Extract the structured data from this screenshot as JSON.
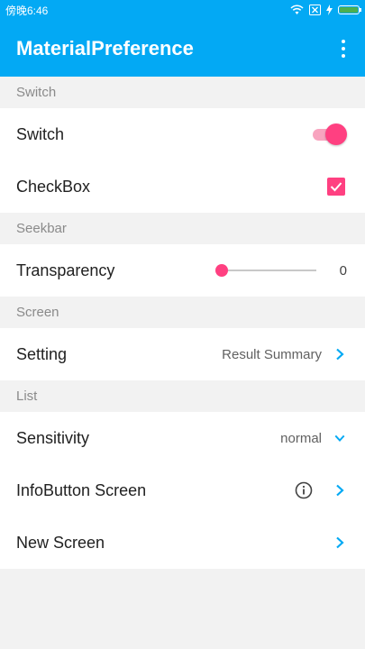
{
  "status": {
    "left_text": "傍晚6:46"
  },
  "app_bar": {
    "title": "MaterialPreference",
    "menu_icon": "overflow-menu-icon"
  },
  "colors": {
    "primary": "#03a9f4",
    "accent": "#ff4081"
  },
  "sections": {
    "switch": {
      "header": "Switch",
      "switch_row": {
        "title": "Switch",
        "checked": true
      },
      "checkbox_row": {
        "title": "CheckBox",
        "checked": true
      }
    },
    "seekbar": {
      "header": "Seekbar",
      "transparency": {
        "title": "Transparency",
        "value": "0"
      }
    },
    "screen": {
      "header": "Screen",
      "setting": {
        "title": "Setting",
        "summary": "Result Summary",
        "icon": "chevron-right-icon"
      }
    },
    "list": {
      "header": "List",
      "sensitivity": {
        "title": "Sensitivity",
        "summary": "normal",
        "icon": "chevron-down-icon"
      },
      "info_button": {
        "title": "InfoButton Screen",
        "info_icon": "info-icon",
        "icon": "chevron-right-icon"
      },
      "new_screen": {
        "title": "New Screen",
        "icon": "chevron-right-icon"
      }
    }
  }
}
